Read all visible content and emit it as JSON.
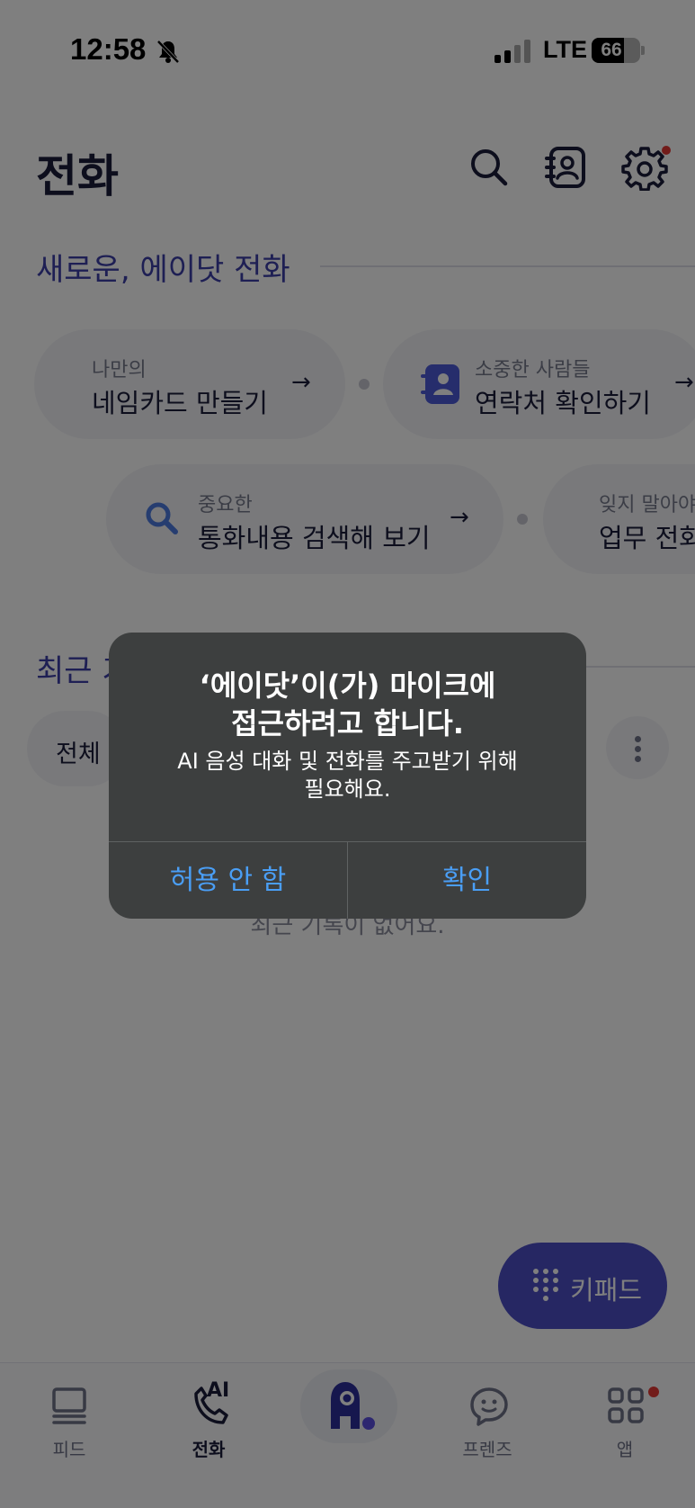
{
  "status_bar": {
    "time": "12:58",
    "network": "LTE",
    "battery": "66",
    "battery_level": 0.66
  },
  "header": {
    "title": "전화"
  },
  "intro": {
    "title": "새로운, 에이닷 전화",
    "cards": [
      {
        "sub": "나만의",
        "main": "네임카드 만들기",
        "arrow": "→"
      },
      {
        "sub": "소중한 사람들",
        "main": "연락처 확인하기",
        "arrow": "→"
      },
      {
        "sub": "중요한",
        "main": "통화내용 검색해 보기",
        "arrow": "→"
      },
      {
        "sub": "잊지 말아야",
        "main": "업무 전화"
      }
    ]
  },
  "recent": {
    "title": "최근 기",
    "filter": "전체",
    "empty": "최근 기록이 없어요."
  },
  "keypad": {
    "label": "키패드"
  },
  "bottom_nav": [
    {
      "label": "피드"
    },
    {
      "label": "전화",
      "badge": "AI"
    },
    {
      "label": ""
    },
    {
      "label": "프렌즈"
    },
    {
      "label": "앱"
    }
  ],
  "alert": {
    "title_line1": "‘에이닷’이(가) 마이크에",
    "title_line2": "접근하려고 합니다.",
    "message_line1": "AI 음성 대화 및 전화를 주고받기 위해",
    "message_line2": "필요해요.",
    "deny": "허용 안 함",
    "confirm": "확인"
  },
  "colors": {
    "accent": "#4c4ec6",
    "alert_bg": "#3d3f3f",
    "alert_button": "#4a9ef5",
    "notification_dot": "#e53935"
  }
}
